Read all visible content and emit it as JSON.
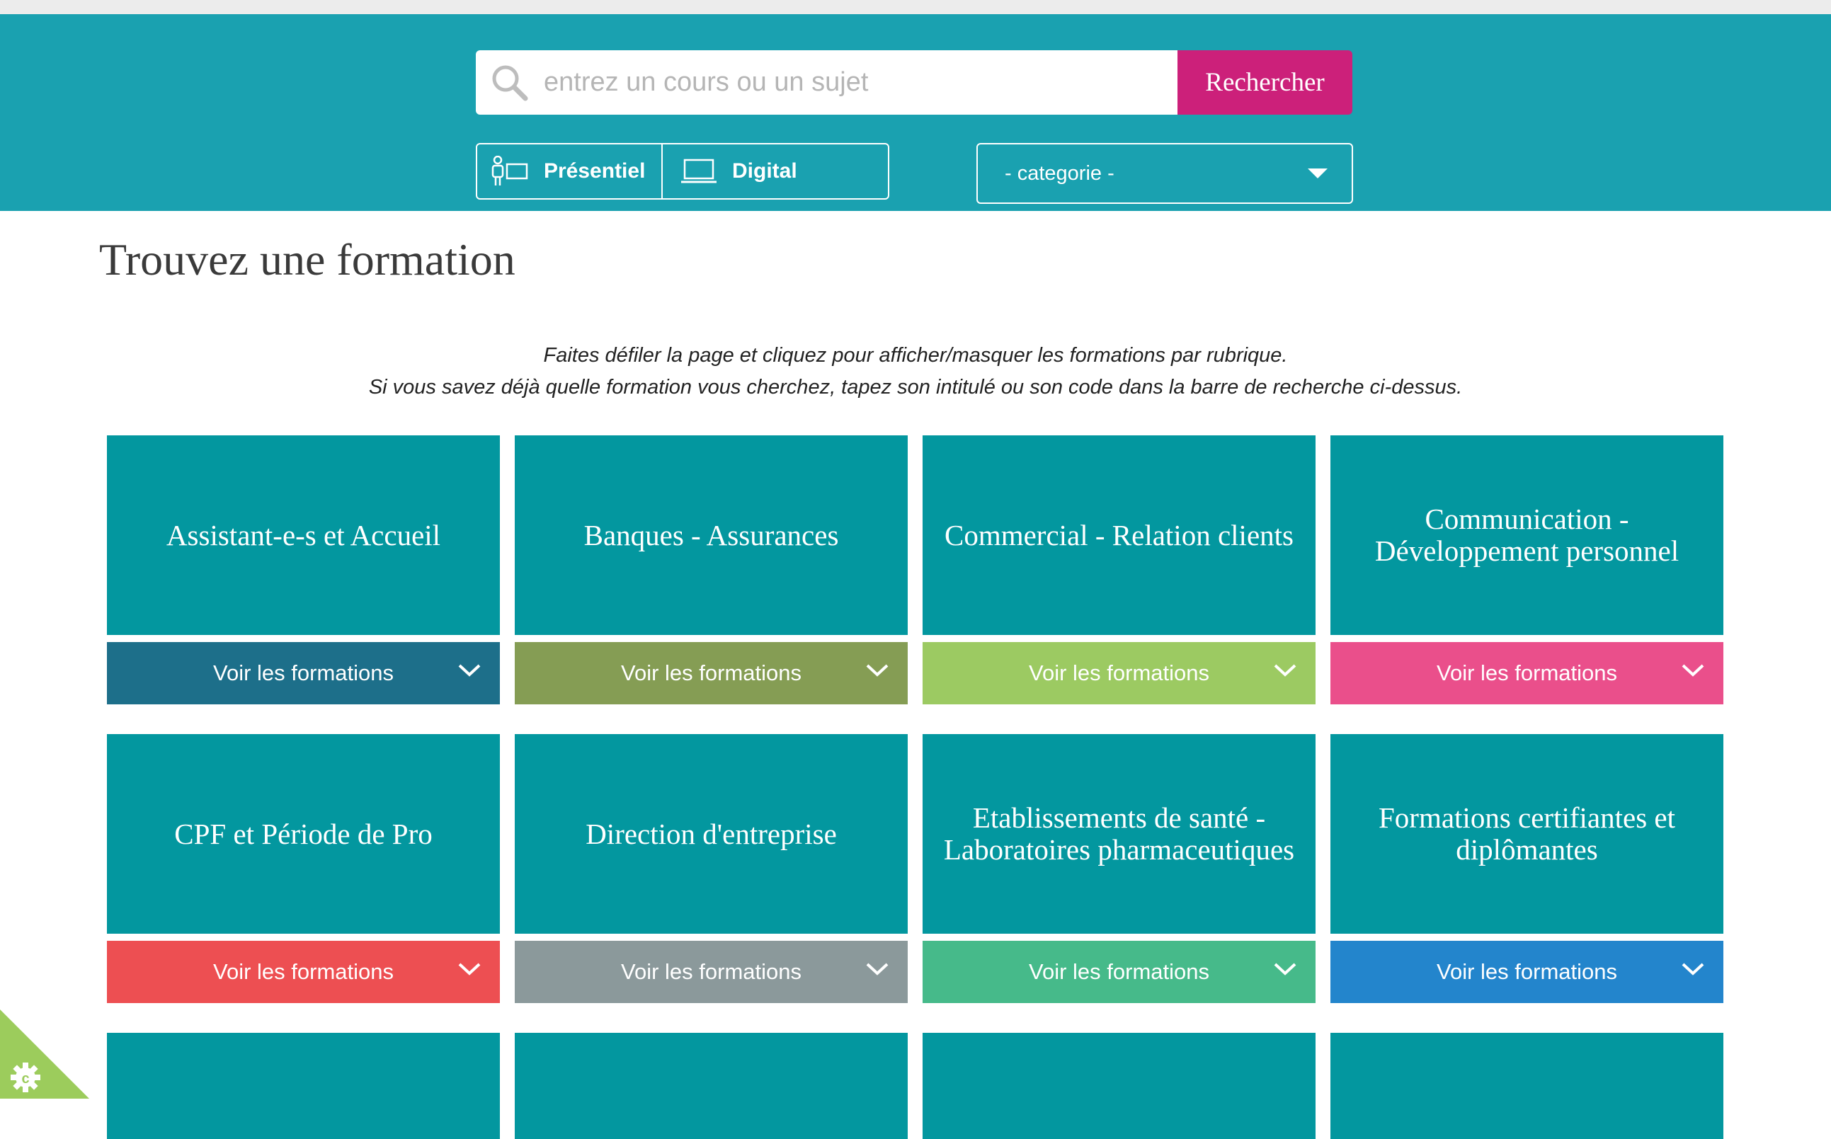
{
  "search": {
    "placeholder": "entrez un cours ou un sujet",
    "button_label": "Rechercher"
  },
  "filters": {
    "presentiel_label": "Présentiel",
    "digital_label": "Digital",
    "category_selected": "- categorie -"
  },
  "page": {
    "title": "Trouvez une formation",
    "instruction_line1": "Faites défiler la page et cliquez pour afficher/masquer les formations par rubrique.",
    "instruction_line2": "Si vous savez déjà quelle formation vous cherchez, tapez son intitulé ou son code dans la barre de recherche ci-dessus."
  },
  "colors": {
    "header": "#1aa1b0",
    "search_button": "#cc207a",
    "tile": "#03979f",
    "cookie_badge": "#9ccc5c"
  },
  "tiles": [
    {
      "title": "Assistant-e-s et Accueil",
      "cta": "Voir les formations",
      "color": "#1d6f8a"
    },
    {
      "title": "Banques - Assurances",
      "cta": "Voir les formations",
      "color": "#859d54"
    },
    {
      "title": "Commercial - Relation clients",
      "cta": "Voir les formations",
      "color": "#9cca62"
    },
    {
      "title": "Communication - Développement personnel",
      "cta": "Voir les formations",
      "color": "#ea4f8b"
    },
    {
      "title": "CPF et Période de Pro",
      "cta": "Voir les formations",
      "color": "#ed4f52"
    },
    {
      "title": "Direction d'entreprise",
      "cta": "Voir les formations",
      "color": "#8b999b"
    },
    {
      "title": "Etablissements de santé - Laboratoires pharmaceutiques",
      "cta": "Voir les formations",
      "color": "#46ba8a"
    },
    {
      "title": "Formations certifiantes et diplômantes",
      "cta": "Voir les formations",
      "color": "#2385cc"
    }
  ]
}
